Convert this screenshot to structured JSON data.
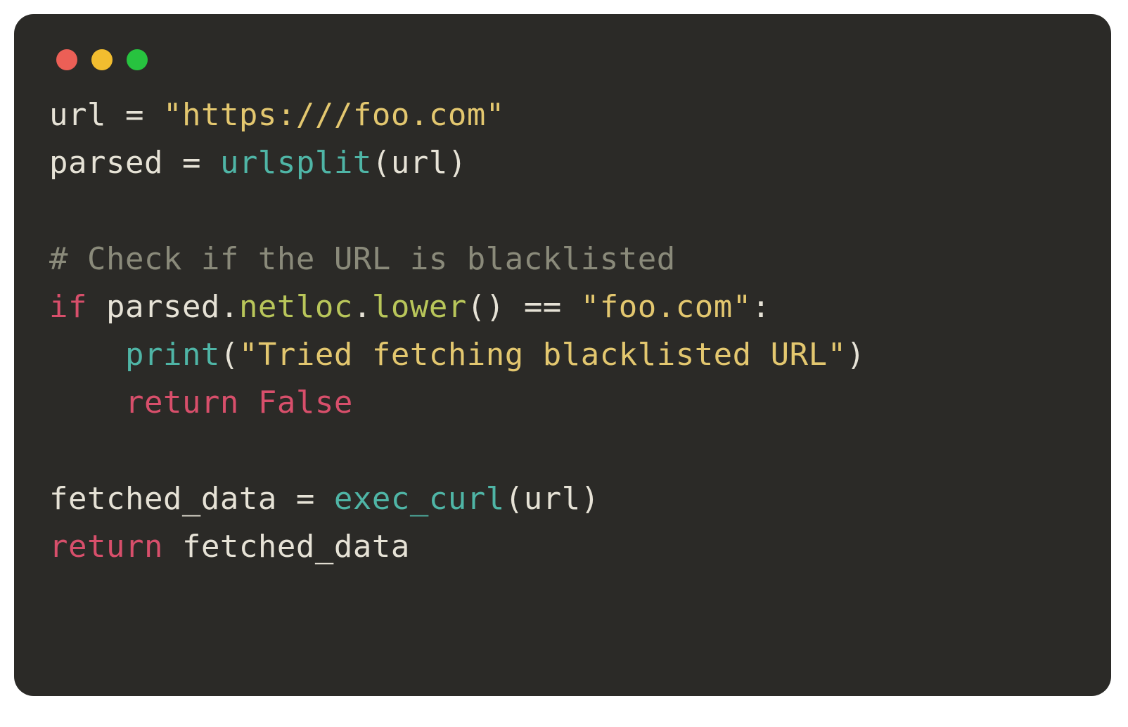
{
  "window": {
    "dots": [
      "red",
      "yellow",
      "green"
    ]
  },
  "colors": {
    "bg": "#2b2a27",
    "text": "#e6e2d6",
    "string": "#e3c76f",
    "func": "#4fb5a6",
    "comment": "#8a8a7a",
    "keyword": "#d84f6b",
    "attr": "#b9c65a",
    "dot_red": "#ec5f56",
    "dot_yellow": "#f2bd2f",
    "dot_green": "#27c33f"
  },
  "code": {
    "line1": {
      "var": "url",
      "eq": " = ",
      "str": "\"https:///foo.com\""
    },
    "line2": {
      "var": "parsed",
      "eq": " = ",
      "func": "urlsplit",
      "args": "(url)"
    },
    "line3_blank": "",
    "line4_comment": "# Check if the URL is blacklisted",
    "line5": {
      "kw_if": "if",
      "sp1": " ",
      "obj": "parsed",
      "dot1": ".",
      "attr": "netloc",
      "dot2": ".",
      "meth": "lower",
      "call": "()",
      "eqeq": " == ",
      "str": "\"foo.com\"",
      "colon": ":"
    },
    "line6": {
      "indent": "    ",
      "func": "print",
      "open": "(",
      "str": "\"Tried fetching blacklisted URL\"",
      "close": ")"
    },
    "line7": {
      "indent": "    ",
      "kw_return": "return",
      "sp": " ",
      "val": "False"
    },
    "line8_blank": "",
    "line9": {
      "var": "fetched_data",
      "eq": " = ",
      "func": "exec_curl",
      "args": "(url)"
    },
    "line10": {
      "kw_return": "return",
      "sp": " ",
      "val": "fetched_data"
    }
  }
}
